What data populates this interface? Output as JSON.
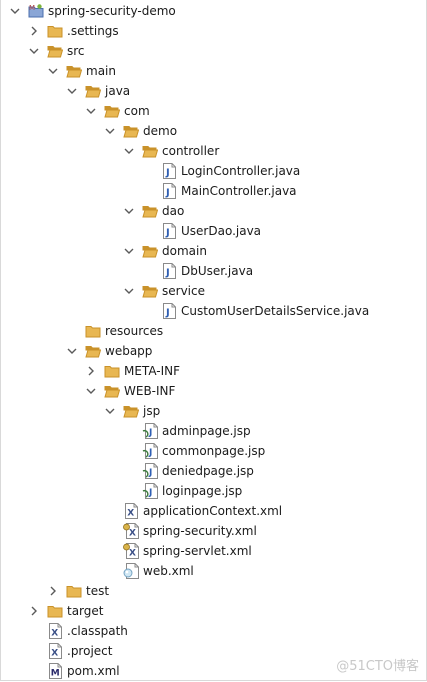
{
  "tree": [
    {
      "label": "spring-security-demo",
      "icon": "project-icon",
      "twisty": "open",
      "depth": 0
    },
    {
      "label": ".settings",
      "icon": "folder-icon",
      "twisty": "closed",
      "depth": 1
    },
    {
      "label": "src",
      "icon": "folder-open-icon",
      "twisty": "open",
      "depth": 1
    },
    {
      "label": "main",
      "icon": "folder-open-icon",
      "twisty": "open",
      "depth": 2
    },
    {
      "label": "java",
      "icon": "folder-open-icon",
      "twisty": "open",
      "depth": 3
    },
    {
      "label": "com",
      "icon": "folder-open-icon",
      "twisty": "open",
      "depth": 4
    },
    {
      "label": "demo",
      "icon": "folder-open-icon",
      "twisty": "open",
      "depth": 5
    },
    {
      "label": "controller",
      "icon": "folder-open-icon",
      "twisty": "open",
      "depth": 6
    },
    {
      "label": "LoginController.java",
      "icon": "java-file-icon",
      "twisty": "none",
      "depth": 7
    },
    {
      "label": "MainController.java",
      "icon": "java-file-icon",
      "twisty": "none",
      "depth": 7
    },
    {
      "label": "dao",
      "icon": "folder-open-icon",
      "twisty": "open",
      "depth": 6
    },
    {
      "label": "UserDao.java",
      "icon": "java-file-icon",
      "twisty": "none",
      "depth": 7
    },
    {
      "label": "domain",
      "icon": "folder-open-icon",
      "twisty": "open",
      "depth": 6
    },
    {
      "label": "DbUser.java",
      "icon": "java-file-icon",
      "twisty": "none",
      "depth": 7
    },
    {
      "label": "service",
      "icon": "folder-open-icon",
      "twisty": "open",
      "depth": 6
    },
    {
      "label": "CustomUserDetailsService.java",
      "icon": "java-file-icon",
      "twisty": "none",
      "depth": 7
    },
    {
      "label": "resources",
      "icon": "folder-icon",
      "twisty": "none",
      "depth": 3
    },
    {
      "label": "webapp",
      "icon": "folder-open-icon",
      "twisty": "open",
      "depth": 3
    },
    {
      "label": "META-INF",
      "icon": "folder-icon",
      "twisty": "closed",
      "depth": 4
    },
    {
      "label": "WEB-INF",
      "icon": "folder-open-icon",
      "twisty": "open",
      "depth": 4
    },
    {
      "label": "jsp",
      "icon": "folder-open-icon",
      "twisty": "open",
      "depth": 5
    },
    {
      "label": "adminpage.jsp",
      "icon": "jsp-file-icon",
      "twisty": "none",
      "depth": 6
    },
    {
      "label": "commonpage.jsp",
      "icon": "jsp-file-icon",
      "twisty": "none",
      "depth": 6
    },
    {
      "label": "deniedpage.jsp",
      "icon": "jsp-file-icon",
      "twisty": "none",
      "depth": 6
    },
    {
      "label": "loginpage.jsp",
      "icon": "jsp-file-icon",
      "twisty": "none",
      "depth": 6
    },
    {
      "label": "applicationContext.xml",
      "icon": "xml-file-icon",
      "twisty": "none",
      "depth": 5
    },
    {
      "label": "spring-security.xml",
      "icon": "spring-xml-file-icon",
      "twisty": "none",
      "depth": 5
    },
    {
      "label": "spring-servlet.xml",
      "icon": "spring-xml-file-icon",
      "twisty": "none",
      "depth": 5
    },
    {
      "label": "web.xml",
      "icon": "webxml-file-icon",
      "twisty": "none",
      "depth": 5
    },
    {
      "label": "test",
      "icon": "folder-icon",
      "twisty": "closed",
      "depth": 2
    },
    {
      "label": "target",
      "icon": "folder-icon",
      "twisty": "closed",
      "depth": 1
    },
    {
      "label": ".classpath",
      "icon": "xml-file-icon",
      "twisty": "none",
      "depth": 1
    },
    {
      "label": ".project",
      "icon": "xml-file-icon",
      "twisty": "none",
      "depth": 1
    },
    {
      "label": "pom.xml",
      "icon": "maven-file-icon",
      "twisty": "none",
      "depth": 1
    }
  ],
  "watermark": "@51CTO博客",
  "colors": {
    "folder": "#e8b752",
    "folder_dark": "#c9922a",
    "java_blue": "#2f5fb3",
    "twisty": "#5a5a5a"
  }
}
